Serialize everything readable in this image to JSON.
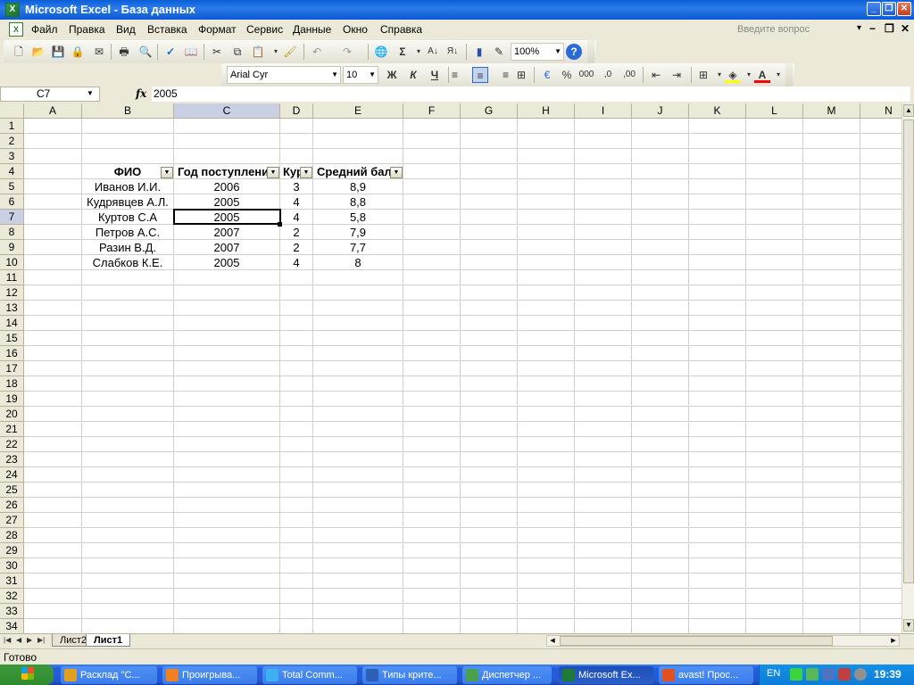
{
  "window": {
    "title": "Microsoft Excel - База данных",
    "min_glyph": "_",
    "max_glyph": "❐",
    "close_glyph": "✕"
  },
  "menu": {
    "items": [
      "Файл",
      "Правка",
      "Вид",
      "Вставка",
      "Формат",
      "Сервис",
      "Данные",
      "Окно",
      "Справка"
    ],
    "help_placeholder": "Введите вопрос",
    "help_arrow": "▾",
    "doc_min": "−",
    "doc_restore": "❐",
    "doc_close": "✕"
  },
  "toolbar_standard": {
    "icons": [
      "new-icon",
      "open-icon",
      "save-icon",
      "permission-icon",
      "print-icon",
      "print-preview-icon",
      "spelling-icon",
      "research-icon",
      "cut-icon",
      "copy-icon",
      "paste-icon",
      "format-painter-icon",
      "undo-icon",
      "redo-icon",
      "hyperlink-icon",
      "autosum-icon",
      "sort-ascending-icon",
      "sort-descending-icon",
      "chart-wizard-icon",
      "drawing-icon",
      "help-icon"
    ],
    "glyphs": {
      "new": "🗋",
      "open": "📂",
      "save": "💾",
      "permission": "🔒",
      "print": "🖶",
      "preview": "🔍",
      "spelling": "✓",
      "research": "📖",
      "cut": "✂",
      "copy": "⧉",
      "paste": "📋",
      "painter": "🖌",
      "undo": "↶",
      "redo": "↷",
      "hyperlink": "🌐",
      "autosum": "Σ",
      "sort_asc": "A↓",
      "sort_desc": "Я↓",
      "chart": "▮",
      "drawing": "✎",
      "help": "?"
    },
    "zoom": "100%"
  },
  "toolbar_formatting": {
    "font_name": "Arial Cyr",
    "font_size": "10",
    "bold": "Ж",
    "italic": "К",
    "underline": "Ч",
    "glyphs": {
      "align_left": "≡",
      "align_center": "≡",
      "align_right": "≡",
      "merge": "⊞",
      "currency": "€",
      "percent": "%",
      "thousands": "000",
      "inc_dec": ",0",
      "dec_dec": ",00",
      "dec_indent": "⇤",
      "inc_indent": "⇥",
      "borders": "⊞",
      "fill": "◈",
      "font_color": "A"
    },
    "accent_fill_color": "#FFFF00",
    "accent_font_color": "#FF0000"
  },
  "formula_bar": {
    "cell_ref": "C7",
    "fx": "fx",
    "value": "2005"
  },
  "grid": {
    "columns": [
      "A",
      "B",
      "C",
      "D",
      "E",
      "F",
      "G",
      "H",
      "I",
      "J",
      "K",
      "L",
      "M",
      "N"
    ],
    "rows": [
      "1",
      "2",
      "3",
      "4",
      "5",
      "6",
      "7",
      "8",
      "9",
      "10",
      "11",
      "12",
      "13",
      "14",
      "15",
      "16",
      "17",
      "18",
      "19",
      "20",
      "21",
      "22",
      "23",
      "24",
      "25",
      "26",
      "27",
      "28",
      "29",
      "30",
      "31",
      "32",
      "33",
      "34"
    ],
    "selected_column": "C",
    "selected_row": "7",
    "table_headers": [
      "ФИО",
      "Год поступлени",
      "Кур",
      "Средний бал"
    ],
    "table_rows": [
      [
        "Иванов И.И.",
        "2006",
        "3",
        "8,9"
      ],
      [
        "Кудрявцев А.Л.",
        "2005",
        "4",
        "8,8"
      ],
      [
        "Куртов С.А",
        "2005",
        "4",
        "5,8"
      ],
      [
        "Петров А.С.",
        "2007",
        "2",
        "7,9"
      ],
      [
        "Разин В.Д.",
        "2007",
        "2",
        "7,7"
      ],
      [
        "Слабков К.Е.",
        "2005",
        "4",
        "8"
      ]
    ],
    "filter_glyph": "▼"
  },
  "sheets": {
    "tabs": [
      "Лист2",
      "Лист1"
    ],
    "active": "Лист1",
    "nav": [
      "|◀",
      "◀",
      "▶",
      "▶|"
    ]
  },
  "status": {
    "text": "Готово"
  },
  "taskbar": {
    "tasks": [
      {
        "label": "Расклад \"С...",
        "color": "#E0A020"
      },
      {
        "label": "Проигрыва...",
        "color": "#F08020"
      },
      {
        "label": "Total Comm...",
        "color": "#3CB0F0"
      },
      {
        "label": "Типы крите...",
        "color": "#2B5FB8"
      },
      {
        "label": "Диспетчер ...",
        "color": "#4CA04C"
      },
      {
        "label": "Microsoft Ex...",
        "color": "#1E7A34"
      },
      {
        "label": "avast! Прос...",
        "color": "#E05020"
      }
    ],
    "active_task": "Microsoft Ex...",
    "lang": "EN",
    "clock": "19:39"
  }
}
